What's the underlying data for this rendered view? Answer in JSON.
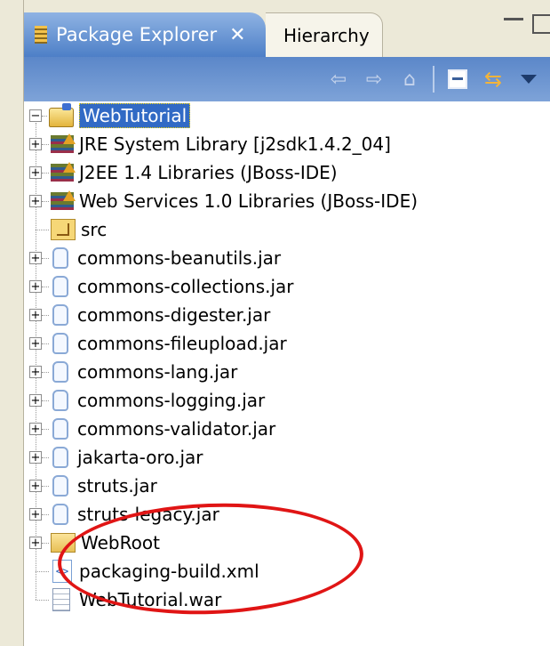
{
  "tabs": {
    "active_label": "Package Explorer",
    "close_glyph": "✕",
    "inactive_label": "Hierarchy"
  },
  "toolbar": {
    "back_icon": "back-arrow-icon",
    "forward_icon": "forward-arrow-icon",
    "up_icon": "up-folder-icon",
    "collapse_icon": "collapse-all-icon",
    "link_icon": "link-with-editor-icon",
    "menu_icon": "view-menu-icon",
    "back_glyph": "⇦",
    "forward_glyph": "⇨",
    "up_glyph": "⌂",
    "link_glyph": "⇆"
  },
  "tree": {
    "project": {
      "label": "WebTutorial",
      "expanded": true
    },
    "children": [
      {
        "label": "JRE System Library [j2sdk1.4.2_04]",
        "icon": "library-icon",
        "expandable": true
      },
      {
        "label": "J2EE 1.4 Libraries (JBoss-IDE)",
        "icon": "library-icon",
        "expandable": true
      },
      {
        "label": "Web Services 1.0 Libraries (JBoss-IDE)",
        "icon": "library-icon",
        "expandable": true
      },
      {
        "label": "src",
        "icon": "source-folder-icon",
        "expandable": false
      },
      {
        "label": "commons-beanutils.jar",
        "icon": "jar-icon",
        "expandable": true
      },
      {
        "label": "commons-collections.jar",
        "icon": "jar-icon",
        "expandable": true
      },
      {
        "label": "commons-digester.jar",
        "icon": "jar-icon",
        "expandable": true
      },
      {
        "label": "commons-fileupload.jar",
        "icon": "jar-icon",
        "expandable": true
      },
      {
        "label": "commons-lang.jar",
        "icon": "jar-icon",
        "expandable": true
      },
      {
        "label": "commons-logging.jar",
        "icon": "jar-icon",
        "expandable": true
      },
      {
        "label": "commons-validator.jar",
        "icon": "jar-icon",
        "expandable": true
      },
      {
        "label": "jakarta-oro.jar",
        "icon": "jar-icon",
        "expandable": true
      },
      {
        "label": "struts.jar",
        "icon": "jar-icon",
        "expandable": true
      },
      {
        "label": "struts-legacy.jar",
        "icon": "jar-icon",
        "expandable": true
      },
      {
        "label": "WebRoot",
        "icon": "folder-icon",
        "expandable": true
      },
      {
        "label": "packaging-build.xml",
        "icon": "xml-file-icon",
        "expandable": false
      },
      {
        "label": "WebTutorial.war",
        "icon": "war-file-icon",
        "expandable": false
      }
    ],
    "expand_glyph": "+",
    "collapse_glyph": "−",
    "xml_glyph": "<>"
  },
  "annotation": {
    "color": "#e01515"
  }
}
